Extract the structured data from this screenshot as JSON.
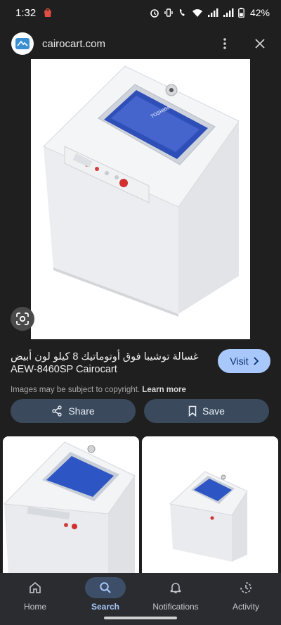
{
  "status": {
    "time": "1:32",
    "battery": "42%"
  },
  "source": {
    "name": "cairocart.com"
  },
  "result": {
    "title_ar": "غسالة توشيبا فوق أوتوماتيك 8 كيلو لون أبيض",
    "title_en": "AEW-8460SP Cairocart",
    "disclaimer": "Images may be subject to copyright.",
    "learn_more": "Learn more",
    "visit_label": "Visit"
  },
  "actions": {
    "share_label": "Share",
    "save_label": "Save"
  },
  "nav": {
    "items": [
      {
        "label": "Home",
        "icon": "home-icon"
      },
      {
        "label": "Search",
        "icon": "search-icon"
      },
      {
        "label": "Notifications",
        "icon": "bell-icon"
      },
      {
        "label": "Activity",
        "icon": "activity-icon"
      }
    ],
    "active": "Search"
  },
  "colors": {
    "accent": "#a8c7fa",
    "background": "#1f1f1f",
    "action_button": "#3a4a5c"
  }
}
